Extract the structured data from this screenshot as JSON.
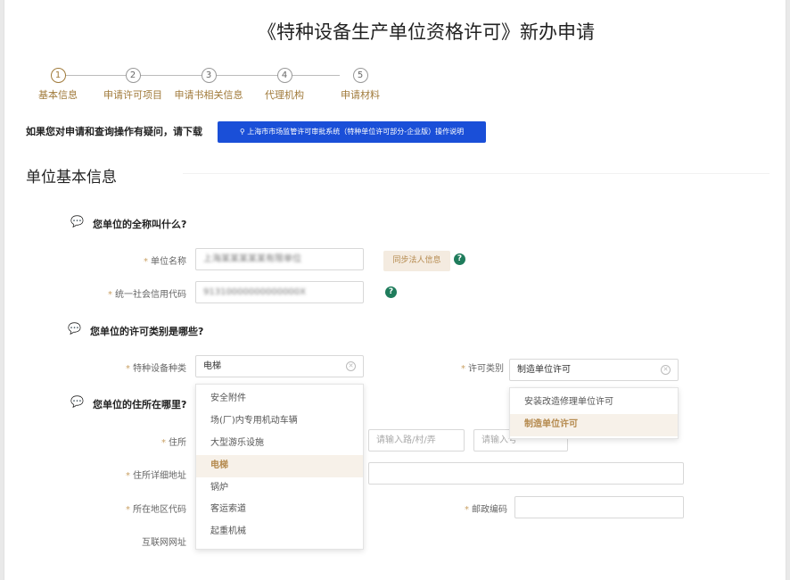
{
  "page_title": "《特种设备生产单位资格许可》新办申请",
  "steps": [
    {
      "num": "1",
      "label": "基本信息"
    },
    {
      "num": "2",
      "label": "申请许可项目"
    },
    {
      "num": "3",
      "label": "申请书相关信息"
    },
    {
      "num": "4",
      "label": "代理机构"
    },
    {
      "num": "5",
      "label": "申请材料"
    }
  ],
  "help": {
    "text": "如果您对申请和查询操作有疑问，请下载",
    "button_label": "⚲ 上海市市场监管许可审批系统（特种单位许可部分-企业版）操作说明"
  },
  "section_title": "单位基本信息",
  "questions": {
    "q1": "您单位的全称叫什么?",
    "q2": "您单位的许可类别是哪些?",
    "q3": "您单位的住所在哪里?"
  },
  "fields": {
    "unit_name": {
      "label": "单位名称",
      "value": "上海某某某某某有限单位"
    },
    "sync_button": "同步法人信息",
    "credit_code": {
      "label": "统一社会信用代码",
      "value": "91310000000000000X"
    },
    "equipment_type": {
      "label": "特种设备种类",
      "value": "电梯"
    },
    "license_category": {
      "label": "许可类别",
      "value": "制造单位许可"
    },
    "address": {
      "label": "住所",
      "road_placeholder": "请输入路/村/弄",
      "number_placeholder": "请输入号"
    },
    "address_detail": {
      "label": "住所详细地址"
    },
    "region_code": {
      "label": "所在地区代码"
    },
    "postal_code": {
      "label": "邮政编码"
    },
    "website": {
      "label": "互联网网址"
    }
  },
  "equipment_options": [
    "安全附件",
    "场(厂)内专用机动车辆",
    "大型游乐设施",
    "电梯",
    "锅炉",
    "客运索道",
    "起重机械"
  ],
  "equipment_selected": "电梯",
  "category_options": [
    "安装改造修理单位许可",
    "制造单位许可"
  ],
  "category_selected": "制造单位许可",
  "colors": {
    "accent": "#b58a4e",
    "button_blue": "#1a4fd8",
    "help_icon": "#1f7c5c"
  }
}
